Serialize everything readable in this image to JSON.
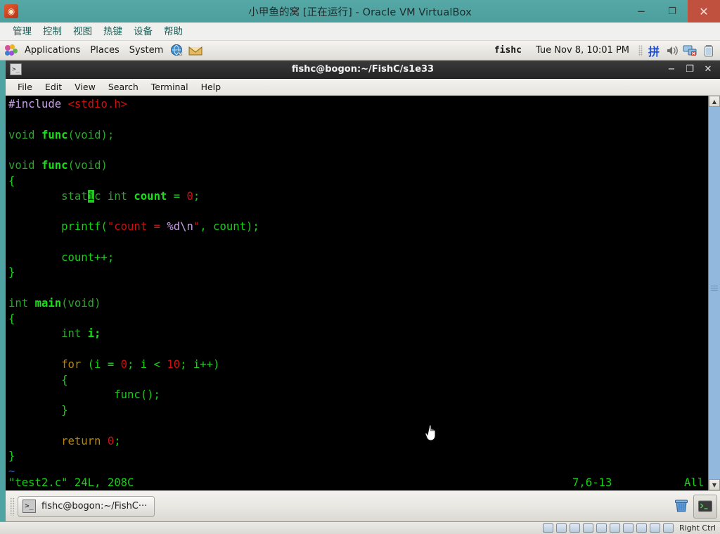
{
  "vbox": {
    "title": "小甲鱼的窝 [正在运行] - Oracle VM VirtualBox",
    "app_icon": "virtualbox-icon",
    "window_buttons": {
      "minimize": "−",
      "maximize": "❐",
      "close": "✕"
    },
    "menu": [
      "管理",
      "控制",
      "视图",
      "热键",
      "设备",
      "帮助"
    ],
    "statusbar": {
      "host_key": "Right Ctrl"
    },
    "colors": {
      "titlebar": "#4fa3a3",
      "close": "#c0513f",
      "accent": "#5aa9e0"
    }
  },
  "gnome_panel": {
    "menus": [
      "Applications",
      "Places",
      "System"
    ],
    "launchers": [
      "web-browser-icon",
      "email-client-icon"
    ],
    "user": "fishc",
    "clock": "Tue Nov  8, 10:01 PM",
    "tray": [
      "input-method-icon",
      "volume-icon",
      "network-disconnected-icon",
      "battery-icon"
    ]
  },
  "terminal": {
    "title": "fishc@bogon:~/FishC/s1e33",
    "icon": "terminal-icon",
    "window_buttons": {
      "minimize": "−",
      "maximize": "❐",
      "close": "✕"
    },
    "menu": [
      "File",
      "Edit",
      "View",
      "Search",
      "Terminal",
      "Help"
    ],
    "status": {
      "file": "\"test2.c\" 24L, 208C",
      "position": "7,6-13",
      "percent": "All"
    },
    "scrollbar": {
      "up": "▲",
      "down": "▼"
    },
    "code_lines": [
      [
        {
          "t": "#include ",
          "c": "c-pre"
        },
        {
          "t": "<stdio.h>",
          "c": "c-str"
        }
      ],
      [],
      [
        {
          "t": "void ",
          "c": "c-type"
        },
        {
          "t": "func",
          "c": "c-ident"
        },
        {
          "t": "(void);",
          "c": "c-type"
        }
      ],
      [],
      [
        {
          "t": "void ",
          "c": "c-type"
        },
        {
          "t": "func",
          "c": "c-ident"
        },
        {
          "t": "(void)",
          "c": "c-type"
        }
      ],
      [
        {
          "t": "{",
          "c": "c-norm"
        }
      ],
      [
        {
          "t": "        stat",
          "c": "c-type"
        },
        {
          "t": "i",
          "c": "cursor"
        },
        {
          "t": "c int ",
          "c": "c-type"
        },
        {
          "t": "count",
          "c": "c-ident"
        },
        {
          "t": " = ",
          "c": "c-norm"
        },
        {
          "t": "0",
          "c": "c-num"
        },
        {
          "t": ";",
          "c": "c-norm"
        }
      ],
      [],
      [
        {
          "t": "        printf(",
          "c": "c-norm"
        },
        {
          "t": "\"count = ",
          "c": "c-str"
        },
        {
          "t": "%d\\n",
          "c": "c-spec"
        },
        {
          "t": "\"",
          "c": "c-str"
        },
        {
          "t": ", count);",
          "c": "c-norm"
        }
      ],
      [],
      [
        {
          "t": "        count++;",
          "c": "c-norm"
        }
      ],
      [
        {
          "t": "}",
          "c": "c-norm"
        }
      ],
      [],
      [
        {
          "t": "int ",
          "c": "c-type"
        },
        {
          "t": "main",
          "c": "c-ident"
        },
        {
          "t": "(void)",
          "c": "c-type"
        }
      ],
      [
        {
          "t": "{",
          "c": "c-norm"
        }
      ],
      [
        {
          "t": "        int ",
          "c": "c-type"
        },
        {
          "t": "i;",
          "c": "c-ident"
        }
      ],
      [],
      [
        {
          "t": "        for",
          "c": "c-stmt"
        },
        {
          "t": " (i = ",
          "c": "c-norm"
        },
        {
          "t": "0",
          "c": "c-num"
        },
        {
          "t": "; i < ",
          "c": "c-norm"
        },
        {
          "t": "10",
          "c": "c-num"
        },
        {
          "t": "; i++)",
          "c": "c-norm"
        }
      ],
      [
        {
          "t": "        {",
          "c": "c-norm"
        }
      ],
      [
        {
          "t": "                func();",
          "c": "c-norm"
        }
      ],
      [
        {
          "t": "        }",
          "c": "c-norm"
        }
      ],
      [],
      [
        {
          "t": "        return",
          "c": "c-stmt"
        },
        {
          "t": " ",
          "c": "c-norm"
        },
        {
          "t": "0",
          "c": "c-num"
        },
        {
          "t": ";",
          "c": "c-norm"
        }
      ],
      [
        {
          "t": "}",
          "c": "c-norm"
        }
      ],
      [
        {
          "t": "~",
          "c": "c-tilde"
        }
      ]
    ]
  },
  "taskbar": {
    "window_button": {
      "label": "fishc@bogon:~/FishC···",
      "icon": "terminal-icon"
    },
    "right_icons": [
      "trash-icon",
      "terminal-icon"
    ]
  }
}
